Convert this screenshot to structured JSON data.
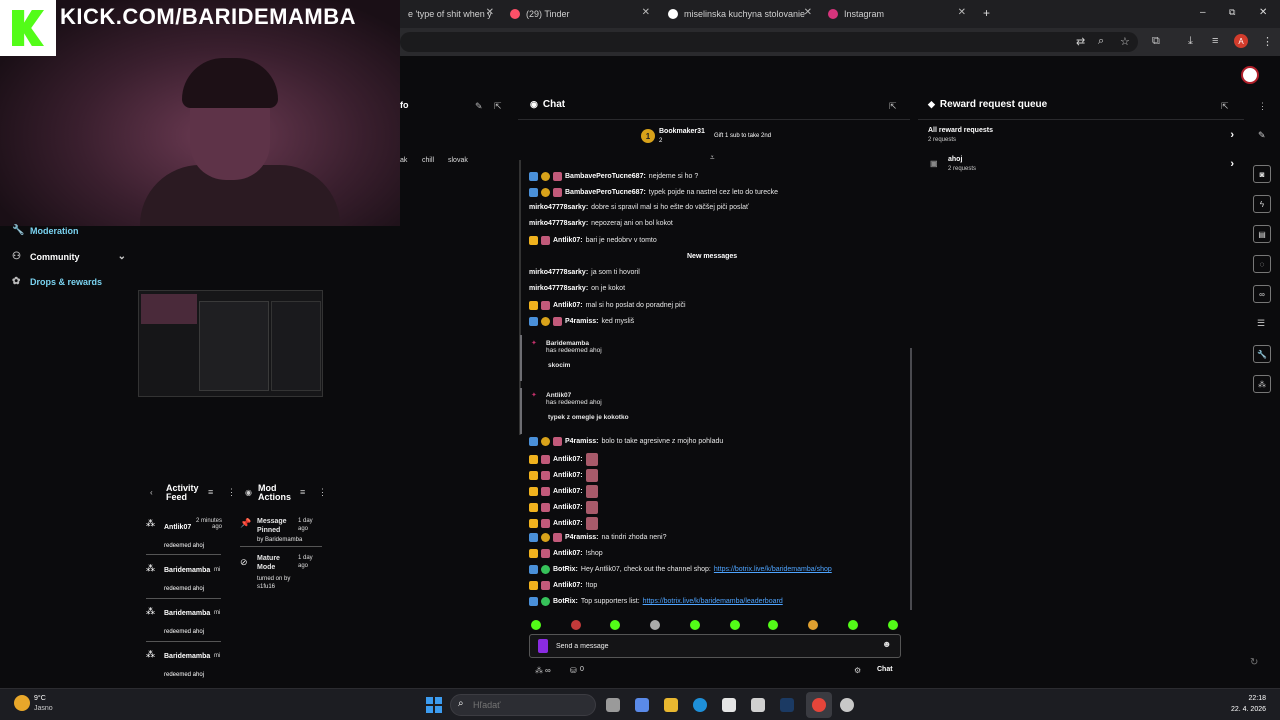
{
  "browser": {
    "tabs": [
      {
        "title": "e 'type of shit when y",
        "icon": "video-icon"
      },
      {
        "title": "(29) Tinder",
        "icon": "tinder-icon"
      },
      {
        "title": "miselinska kuchyna stolovanie",
        "icon": "google-icon"
      },
      {
        "title": "Instagram",
        "icon": "instagram-icon"
      }
    ],
    "new_tab": "+",
    "window_min": "–",
    "window_max": "⧉",
    "window_close": "✕",
    "avatar_letter": "A"
  },
  "overlay": {
    "channel_url": "KICK.COM/BARIDEMAMBA"
  },
  "sidebar": {
    "items": [
      {
        "label": "Moderation",
        "icon": "wrench-icon"
      },
      {
        "label": "Community",
        "icon": "people-icon"
      },
      {
        "label": "Drops & rewards",
        "icon": "gift-icon"
      }
    ],
    "community_chevron": "⌄"
  },
  "stream_info": {
    "title_fragment": "fo",
    "tags": [
      "ak",
      "chill",
      "slovak"
    ]
  },
  "activity_feed": {
    "title": "Activity Feed",
    "items": [
      {
        "user": "Antlik07",
        "time": "2 minutes ago",
        "action": "redeemed ahoj"
      },
      {
        "user": "Baridemamba",
        "time": "mi",
        "action": "redeemed ahoj"
      },
      {
        "user": "Baridemamba",
        "time": "mi",
        "action": "redeemed ahoj"
      },
      {
        "user": "Baridemamba",
        "time": "mi",
        "action": "redeemed ahoj"
      }
    ]
  },
  "mod_actions": {
    "title": "Mod Actions",
    "items": [
      {
        "action": "Message Pinned",
        "time": "1 day ago",
        "by": "by Baridemamba"
      },
      {
        "action": "Mature Mode",
        "time": "1 day ago",
        "by": "turned on by s1fu16"
      }
    ]
  },
  "chat": {
    "title": "Chat",
    "pinned": {
      "user": "Bookmaker31",
      "count": "2",
      "note": "Gift 1 sub to take 2nd"
    },
    "new_messages_label": "New messages",
    "messages": [
      {
        "user": "BambavePeroTucne687:",
        "text": "nejdeme si ho ?",
        "badges": [
          "b-blue",
          "b-gold",
          "b-pink"
        ]
      },
      {
        "user": "BambavePeroTucne687:",
        "text": "typek pojde na nastrel cez leto do turecke",
        "badges": [
          "b-blue",
          "b-gold",
          "b-pink"
        ]
      },
      {
        "user": "mirko47778sarky:",
        "text": "dobre si spravil mal si ho ešte do väčšej piči poslať",
        "badges": []
      },
      {
        "user": "mirko47778sarky:",
        "text": "nepozeraj ani on bol kokot",
        "badges": []
      },
      {
        "user": "Antlik07:",
        "text": "bari je nedobrv v tomto",
        "badges": [
          "b-crown",
          "b-pink"
        ]
      },
      {
        "user": "mirko47778sarky:",
        "text": "ja som ti hovoril",
        "badges": []
      },
      {
        "user": "mirko47778sarky:",
        "text": "on je kokot",
        "badges": []
      },
      {
        "user": "Antlik07:",
        "text": "mal si ho poslat do poradnej piči",
        "badges": [
          "b-crown",
          "b-pink"
        ]
      },
      {
        "user": "P4ramiss:",
        "text": "ked mysliš",
        "badges": [
          "b-blue",
          "b-gold",
          "b-pink"
        ]
      },
      {
        "user": "P4ramiss:",
        "text": "bolo to take agresivne z mojho pohladu",
        "badges": [
          "b-blue",
          "b-gold",
          "b-pink"
        ]
      },
      {
        "user": "Antlik07:",
        "text": "",
        "badges": [
          "b-crown",
          "b-pink"
        ],
        "emote": true
      },
      {
        "user": "Antlik07:",
        "text": "",
        "badges": [
          "b-crown",
          "b-pink"
        ],
        "emote": true
      },
      {
        "user": "Antlik07:",
        "text": "",
        "badges": [
          "b-crown",
          "b-pink"
        ],
        "emote": true
      },
      {
        "user": "Antlik07:",
        "text": "",
        "badges": [
          "b-crown",
          "b-pink"
        ],
        "emote": true
      },
      {
        "user": "Antlik07:",
        "text": "",
        "badges": [
          "b-crown",
          "b-pink"
        ],
        "emote": true
      },
      {
        "user": "P4ramiss:",
        "text": "na tindri zhoda neni?",
        "badges": [
          "b-blue",
          "b-gold",
          "b-pink"
        ]
      },
      {
        "user": "Antlik07:",
        "text": "!shop",
        "badges": [
          "b-crown",
          "b-pink"
        ]
      },
      {
        "user": "BotRix:",
        "text": "Hey Antlik07, check out the channel shop: ",
        "link": "https://botrix.live/k/baridemamba/shop",
        "badges": [
          "b-blue",
          "b-green"
        ]
      },
      {
        "user": "Antlik07:",
        "text": "!top",
        "badges": [
          "b-crown",
          "b-pink"
        ]
      },
      {
        "user": "BotRix:",
        "text": "Top supporters list: ",
        "link": "https://botrix.live/k/baridemamba/leaderboard",
        "badges": [
          "b-blue",
          "b-green"
        ]
      }
    ],
    "redemptions": [
      {
        "user": "Baridemamba",
        "action": "has redeemed ahoj",
        "message": "skocim"
      },
      {
        "user": "Antlik07",
        "action": "has redeemed ahoj",
        "message": "typek z omegle je kokotko"
      }
    ],
    "input_placeholder": "Send a message",
    "viewers": "∞",
    "points": "0",
    "send_label": "Chat"
  },
  "reward_queue": {
    "title": "Reward request queue",
    "items": [
      {
        "title": "All reward requests",
        "sub": "2 requests"
      },
      {
        "title": "ahoj",
        "sub": "2 requests"
      }
    ]
  },
  "taskbar": {
    "weather_temp": "9°C",
    "weather_desc": "Jasno",
    "search_placeholder": "Hľadať",
    "time": "22:18",
    "date": "22. 4. 2026"
  }
}
